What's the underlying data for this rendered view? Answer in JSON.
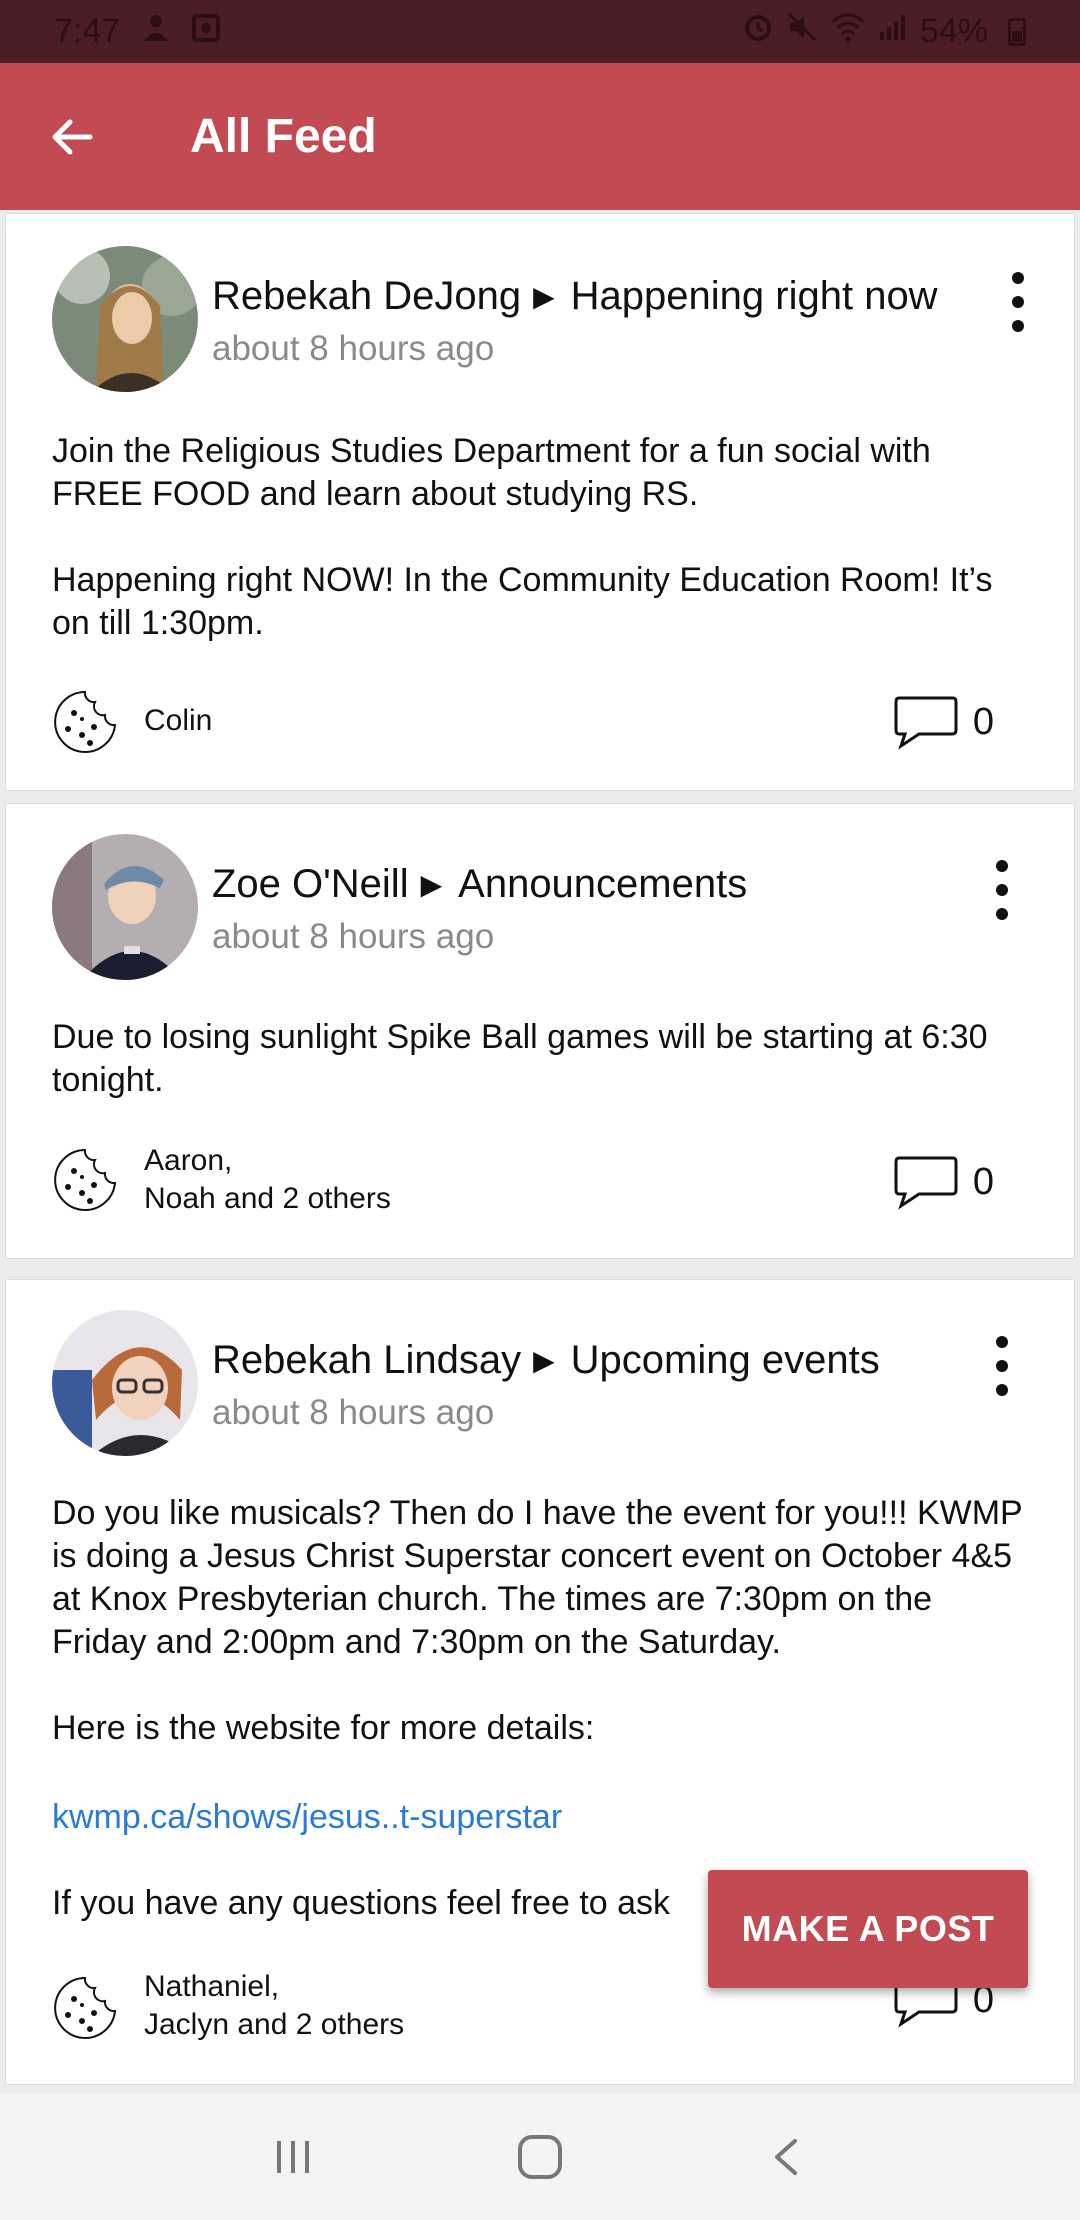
{
  "status_bar": {
    "time": "7:47",
    "battery": "54%",
    "icons": [
      "person-icon",
      "media-icon",
      "alarm-icon",
      "mute-icon",
      "wifi-icon",
      "signal-icon",
      "battery-icon"
    ]
  },
  "app_bar": {
    "title": "All Feed",
    "back_icon": "arrow-left-icon",
    "background": "#c24a52"
  },
  "posts": [
    {
      "author": "Rebekah DeJong",
      "group": "Happening right now",
      "time": "about 8 hours ago",
      "body": "Join the Religious Studies Department for a fun social with FREE FOOD and learn about studying RS.\n\nHappening right NOW! In the Community Education Room! It’s on till 1:30pm.",
      "likers_line1": "Colin",
      "likers_line2": "",
      "comments": "0"
    },
    {
      "author": "Zoe O'Neill",
      "group": "Announcements",
      "time": "about 8 hours ago",
      "body": "Due to losing sunlight Spike Ball games will be starting at 6:30 tonight.",
      "likers_line1": "Aaron,",
      "likers_line2": "Noah and 2 others",
      "comments": "0"
    },
    {
      "author": "Rebekah Lindsay",
      "group": "Upcoming events",
      "time": "about 8 hours ago",
      "body": "Do you like musicals? Then do I have the event for you!!! KWMP is doing a Jesus Christ Superstar concert event on October 4&5 at Knox Presbyterian church. The times are 7:30pm on the Friday and 2:00pm and 7:30pm on the Saturday.\n\nHere is the website for more details:",
      "link": "kwmp.ca/shows/jesus..t-superstar",
      "body_after": "If you have any questions feel free to ask",
      "likers_line1": "Nathaniel,",
      "likers_line2": "Jaclyn and 2 others",
      "comments": "0"
    }
  ],
  "fab": {
    "label": "MAKE A POST",
    "color": "#c24a52"
  },
  "nav_bar": {
    "icons": [
      "recent-apps-icon",
      "home-icon",
      "back-icon"
    ]
  }
}
